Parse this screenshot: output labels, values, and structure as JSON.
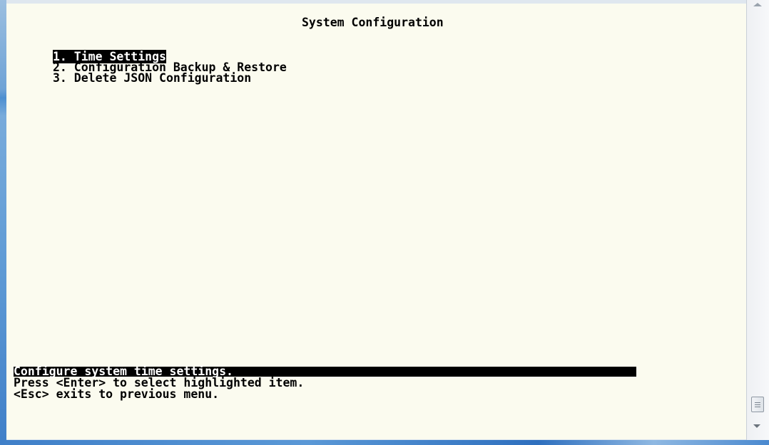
{
  "screen": {
    "title": "System Configuration"
  },
  "menu": {
    "items": [
      {
        "label": "1. Time Settings",
        "selected": true
      },
      {
        "label": "2. Configuration Backup & Restore",
        "selected": false
      },
      {
        "label": "3. Delete JSON Configuration",
        "selected": false
      }
    ]
  },
  "footer": {
    "status": "Configure system time settings.",
    "help_line_1": "Press <Enter> to select highlighted item.",
    "help_line_2": "<Esc> exits to previous menu."
  },
  "colors": {
    "terminal_background": "#fbfbef",
    "text": "#000000",
    "highlight_background": "#000000",
    "highlight_text": "#ffffff"
  }
}
